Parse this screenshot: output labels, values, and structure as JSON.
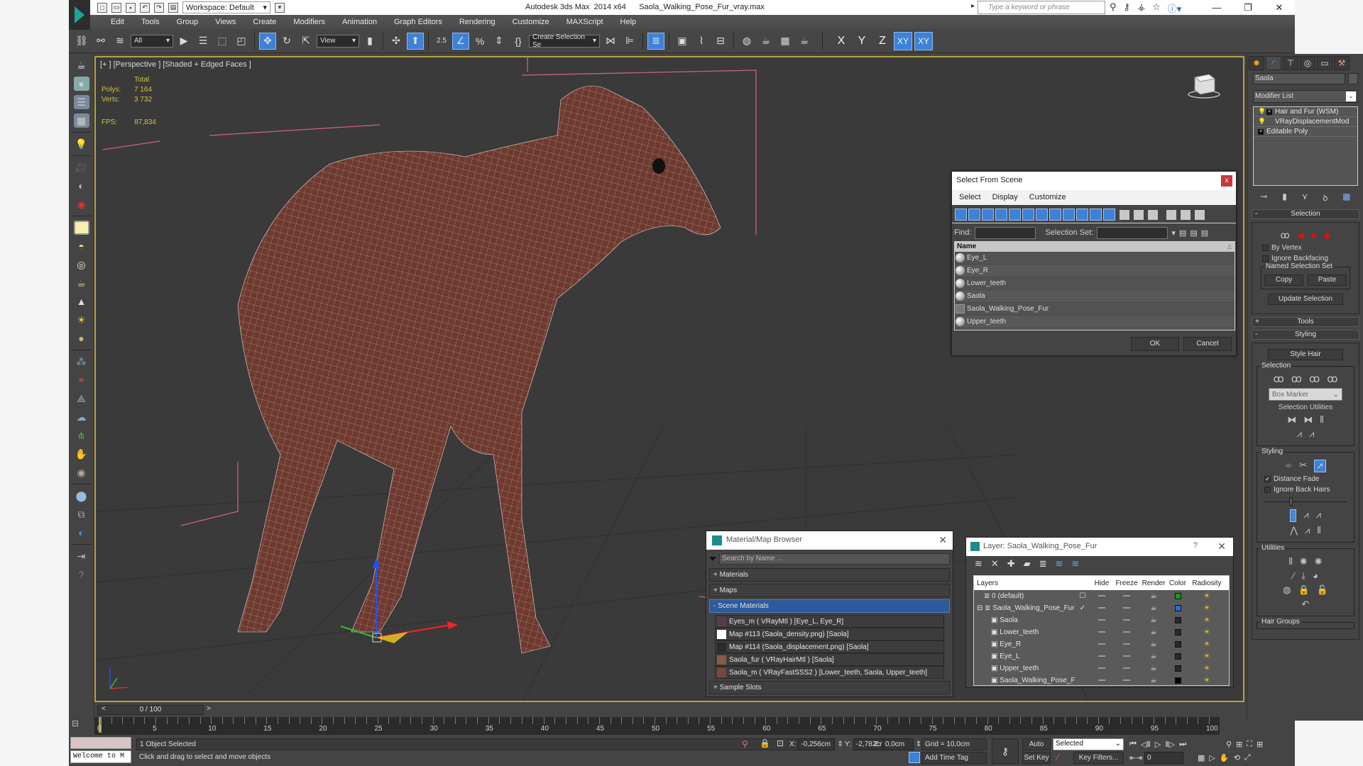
{
  "window": {
    "app_title": "Autodesk 3ds Max  2014 x64",
    "file_name": "Saola_Walking_Pose_Fur_vray.max",
    "workspace": "Workspace: Default",
    "search_placeholder": "Type a keyword or phrase",
    "controls": [
      "minimize",
      "restore",
      "close"
    ]
  },
  "menu": [
    "Edit",
    "Tools",
    "Group",
    "Views",
    "Create",
    "Modifiers",
    "Animation",
    "Graph Editors",
    "Rendering",
    "Customize",
    "MAXScript",
    "Help"
  ],
  "toolbar": {
    "selection_filter": "All",
    "ref_coord": "View",
    "snap_angle": "2.5",
    "named_selection_placeholder": "Create Selection Se",
    "axes": [
      "X",
      "Y",
      "Z",
      "XY",
      "XY"
    ]
  },
  "viewport": {
    "label": "[+ ] [Perspective ] [Shaded + Edged Faces ]",
    "stats_header": "Total",
    "polys_label": "Polys:",
    "polys": "7 164",
    "verts_label": "Verts:",
    "verts": "3 732",
    "fps_label": "FPS:",
    "fps": "87,834"
  },
  "select_from_scene": {
    "title": "Select From Scene",
    "menu": [
      "Select",
      "Display",
      "Customize"
    ],
    "find_label": "Find:",
    "selection_set_label": "Selection Set:",
    "column_header": "Name",
    "items": [
      {
        "name": "Eye_L",
        "icon": "geometry-sphere-icon"
      },
      {
        "name": "Eye_R",
        "icon": "geometry-sphere-icon"
      },
      {
        "name": "Lower_teeth",
        "icon": "geometry-sphere-icon"
      },
      {
        "name": "Saola",
        "icon": "geometry-sphere-icon"
      },
      {
        "name": "Saola_Walking_Pose_Fur",
        "icon": "group-icon"
      },
      {
        "name": "Upper_teeth",
        "icon": "geometry-sphere-icon"
      }
    ],
    "ok_label": "OK",
    "cancel_label": "Cancel"
  },
  "material_browser": {
    "title": "Material/Map Browser",
    "search_placeholder": "Search by Name ...",
    "categories": [
      {
        "label": "+ Materials"
      },
      {
        "label": "+ Maps"
      },
      {
        "label": "- Scene Materials"
      }
    ],
    "scene_materials": [
      {
        "label": "Eyes_m  ( VRayMtl ) [Eye_L, Eye_R]",
        "swatch": "#5a3a4a"
      },
      {
        "label": "Map #113 (Saola_density.png)  [Saola]",
        "swatch": "#ffffff"
      },
      {
        "label": "Map #114 (Saola_displacement.png)  [Saola]",
        "swatch": "#2a2a2a"
      },
      {
        "label": "Saola_fur  ( VRayHairMtl )  [Saola]",
        "swatch": "#8a5a48"
      },
      {
        "label": "Saola_m  ( VRayFastSSS2 )  [Lower_teeth, Saola, Upper_teeth]",
        "swatch": "#7a4838"
      }
    ],
    "sample_slots_label": "+ Sample Slots"
  },
  "layer_manager": {
    "title": "Layer: Saola_Walking_Pose_Fur",
    "help": "?",
    "columns": [
      "Layers",
      "",
      "Hide",
      "Freeze",
      "Render",
      "Color",
      "Radiosity"
    ],
    "rows": [
      {
        "name": "0 (default)",
        "indent": 1,
        "active": "☐",
        "color": "#1a9a1a"
      },
      {
        "name": "Saola_Walking_Pose_Fur",
        "indent": 0,
        "active": "✓",
        "color": "#2a6ad8"
      },
      {
        "name": "Saola",
        "indent": 2,
        "active": "",
        "color": "#2a2a2a"
      },
      {
        "name": "Lower_teeth",
        "indent": 2,
        "active": "",
        "color": "#2a2a2a"
      },
      {
        "name": "Eye_R",
        "indent": 2,
        "active": "",
        "color": "#2a2a2a"
      },
      {
        "name": "Eye_L",
        "indent": 2,
        "active": "",
        "color": "#2a2a2a"
      },
      {
        "name": "Upper_teeth",
        "indent": 2,
        "active": "",
        "color": "#2a2a2a"
      },
      {
        "name": "Saola_Walking_Pose_F",
        "indent": 2,
        "active": "",
        "color": "#000000"
      }
    ]
  },
  "command_panel": {
    "object_name": "Saola",
    "modifier_list_label": "Modifier List",
    "stack": [
      {
        "label": "Hair and Fur (WSM)",
        "bulb": true,
        "expand": true
      },
      {
        "label": "VRayDisplacementMod",
        "bulb": true,
        "expand": false
      },
      {
        "label": "Editable Poly",
        "bulb": false,
        "expand": true
      }
    ],
    "selection_rollout": "Selection",
    "by_vertex": "By Vertex",
    "ignore_backfacing": "Ignore Backfacing",
    "named_selection_set": "Named Selection Set",
    "copy": "Copy",
    "paste": "Paste",
    "update_selection": "Update Selection",
    "tools_rollout": "Tools",
    "styling_rollout": "Styling",
    "style_hair": "Style Hair",
    "selection_group": "Selection",
    "box_marker": "Box Marker",
    "selection_utilities": "Selection Utilities",
    "styling_group": "Styling",
    "distance_fade": "Distance Fade",
    "distance_fade_checked": true,
    "ignore_back_hairs": "Ignore Back Hairs",
    "ignore_back_hairs_checked": false,
    "brush_slider_fraction": 0.3,
    "utilities_group": "Utilities",
    "hair_groups_group": "Hair Groups"
  },
  "timeline": {
    "slider_label": "0 / 100",
    "current_frame": 0,
    "total_frames": 100,
    "tick_labels": [
      "0",
      "5",
      "10",
      "15",
      "20",
      "25",
      "30",
      "35",
      "40",
      "45",
      "50",
      "55",
      "60",
      "65",
      "70",
      "75",
      "80",
      "85",
      "90",
      "95",
      "100"
    ]
  },
  "status": {
    "listener_text": "Welcome to M",
    "selection_status": "1 Object Selected",
    "prompt": "Click and drag to select and move objects",
    "x_label": "X:",
    "x": "-0,256cm",
    "y_label": "Y:",
    "y": "-2,782cm",
    "z_label": "Z:",
    "z": "0,0cm",
    "grid": "Grid = 10,0cm",
    "add_time_tag": "Add Time Tag",
    "auto_key": "Auto Key",
    "set_key": "Set Key",
    "key_mode": "Selected",
    "key_filters": "Key Filters...",
    "frame": "0"
  }
}
